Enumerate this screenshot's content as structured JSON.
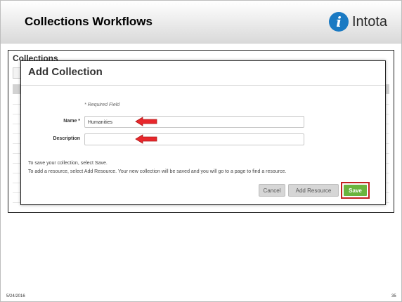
{
  "slide": {
    "title": "Collections Workflows",
    "logo_text": "Intota",
    "logo_glyph": "i",
    "footer_date": "5/24/2016",
    "page_number": "35"
  },
  "background_page": {
    "title": "Collections"
  },
  "modal": {
    "title": "Add Collection",
    "required_note": "* Required Field",
    "fields": {
      "name_label": "Name *",
      "name_value": "Humanities",
      "description_label": "Description",
      "description_value": ""
    },
    "info_line1": "To save your collection, select Save.",
    "info_line2": "To add a resource, select Add Resource. Your new collection will be saved and you will go to a page to find a resource.",
    "buttons": {
      "cancel": "Cancel",
      "add_resource": "Add Resource",
      "save": "Save"
    }
  },
  "colors": {
    "save_button": "#6ab43e",
    "highlight_box": "#c32020",
    "arrow": "#e8272c",
    "logo": "#1a7ac3"
  },
  "icons": {
    "arrow": "red-left-arrow-icon",
    "logo": "info-i-logo-icon"
  }
}
